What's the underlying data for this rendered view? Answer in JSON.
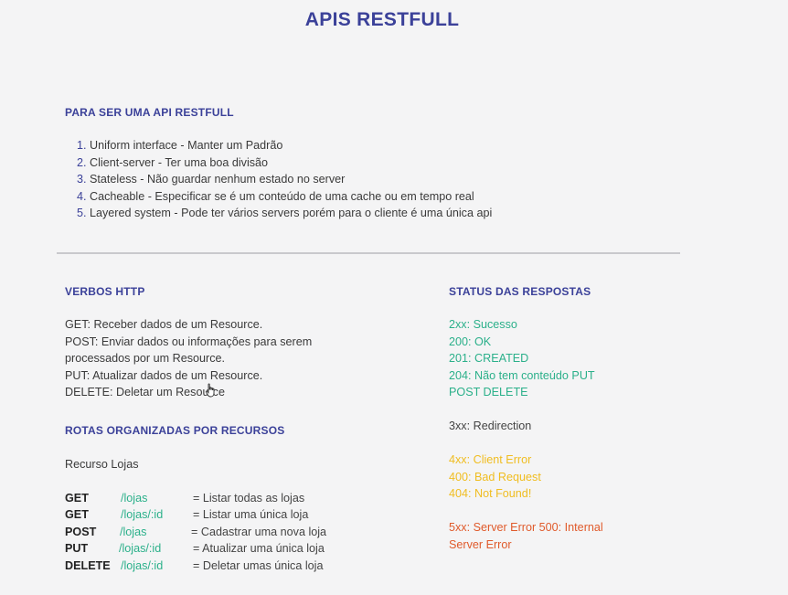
{
  "title": "APIS RESTFULL",
  "section1": {
    "heading": "PARA SER UMA API RESTFULL",
    "items": [
      {
        "num": "1.",
        "text": "Uniform interface - Manter um Padrão"
      },
      {
        "num": "2.",
        "text": "Client-server - Ter uma boa divisão"
      },
      {
        "num": "3.",
        "text": "Stateless - Não guardar nenhum estado no server"
      },
      {
        "num": "4.",
        "text": "Cacheable - Especificar se é um conteúdo de uma cache ou em tempo real"
      },
      {
        "num": "5.",
        "text": "Layered system - Pode ter vários servers porém para o cliente é uma única api"
      }
    ]
  },
  "verbs": {
    "heading": "VERBOS HTTP",
    "lines": [
      "GET: Receber dados de um Resource.",
      "POST: Enviar dados ou informações para serem",
      "processados por um Resource.",
      "PUT: Atualizar dados de um Resource.",
      "DELETE: Deletar um Resource"
    ]
  },
  "routes": {
    "heading": "ROTAS ORGANIZADAS POR RECURSOS",
    "resource": "Recurso Lojas",
    "rows": [
      {
        "method": "GET",
        "path": "/lojas",
        "desc": "= Listar todas as lojas"
      },
      {
        "method": "GET",
        "path": "/lojas/:id",
        "desc": "= Listar uma única loja"
      },
      {
        "method": "POST",
        "path": "/lojas",
        "desc": "= Cadastrar uma nova loja"
      },
      {
        "method": "PUT",
        "path": "/lojas/:id",
        "desc": "= Atualizar uma única loja"
      },
      {
        "method": "DELETE",
        "path": "/lojas/:id",
        "desc": "= Deletar umas única loja"
      }
    ]
  },
  "status": {
    "heading": "STATUS DAS RESPOSTAS",
    "success": [
      "2xx: Sucesso",
      "200: OK",
      "201: CREATED",
      "204: Não tem conteúdo PUT",
      "POST DELETE"
    ],
    "redirect": [
      "3xx: Redirection"
    ],
    "client": [
      "4xx: Client Error",
      "400: Bad Request",
      "404: Not Found!"
    ],
    "server": [
      "5xx: Server Error 500: Internal",
      "Server Error"
    ]
  },
  "colors": {
    "heading": "#3b4199",
    "success": "#2bb08a",
    "client_error": "#f0bd20",
    "server_error": "#e05a2b"
  },
  "icons": {
    "cursor": "hand-pointer-icon"
  }
}
